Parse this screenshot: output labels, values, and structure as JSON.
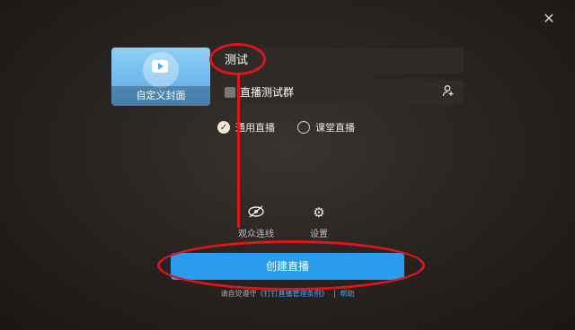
{
  "window": {
    "close_symbol": "✕"
  },
  "cover": {
    "caption": "自定义封面"
  },
  "title_input": {
    "value": "测试"
  },
  "group": {
    "name": "直播测试群",
    "add_member_icon": "person-add-icon"
  },
  "modes": [
    {
      "label": "通用直播",
      "checked": true
    },
    {
      "label": "课堂直播",
      "checked": false
    }
  ],
  "tools": {
    "audience_link_label": "观众连线",
    "settings_label": "设置"
  },
  "create_button": {
    "label": "创建直播"
  },
  "footer": {
    "prefix": "请自觉遵守",
    "rules_link": "《钉钉直播管理条例》",
    "help_link": "帮助"
  },
  "colors": {
    "accent": "#2a9cf0",
    "annotation": "#e0141a"
  }
}
